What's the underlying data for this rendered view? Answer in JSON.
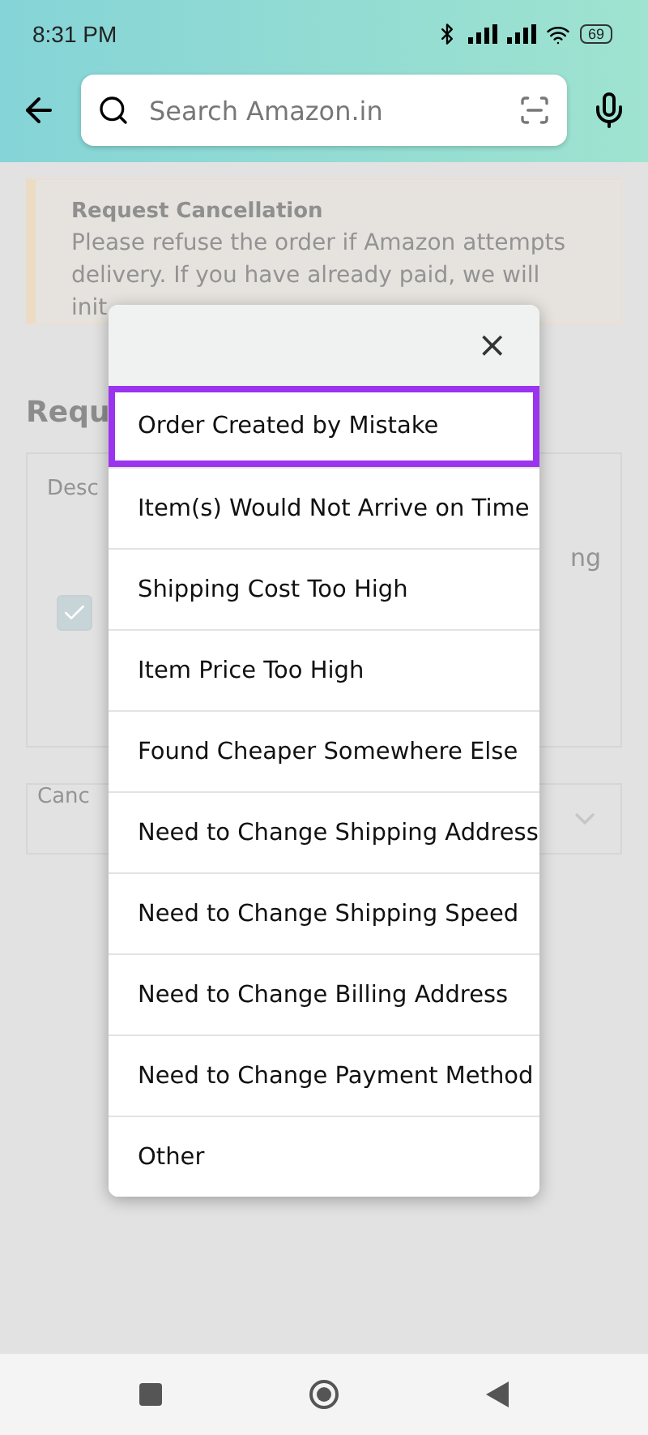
{
  "status_bar": {
    "time": "8:31 PM",
    "battery": "69"
  },
  "header": {
    "search": {
      "placeholder": "Search Amazon.in"
    }
  },
  "background": {
    "notice": {
      "title": "Request Cancellation",
      "lines": [
        "Please refuse the order if Amazon attempts",
        "delivery. If you have already paid, we will",
        "init"
      ]
    },
    "heading": "Requ",
    "box_label": "Desc",
    "box_right_text": "ng",
    "checkbox": {
      "checked": true
    },
    "dropdown": {
      "value": "Canc"
    }
  },
  "modal": {
    "close": "×",
    "reasons": [
      {
        "label": "Order Created by Mistake",
        "selected": true
      },
      {
        "label": "Item(s) Would Not Arrive on Time",
        "selected": false
      },
      {
        "label": "Shipping Cost Too High",
        "selected": false
      },
      {
        "label": "Item Price Too High",
        "selected": false
      },
      {
        "label": "Found Cheaper Somewhere Else",
        "selected": false
      },
      {
        "label": "Need to Change Shipping Address",
        "selected": false
      },
      {
        "label": "Need to Change Shipping Speed",
        "selected": false
      },
      {
        "label": "Need to Change Billing Address",
        "selected": false
      },
      {
        "label": "Need to Change Payment Method",
        "selected": false
      },
      {
        "label": "Other",
        "selected": false
      }
    ]
  }
}
